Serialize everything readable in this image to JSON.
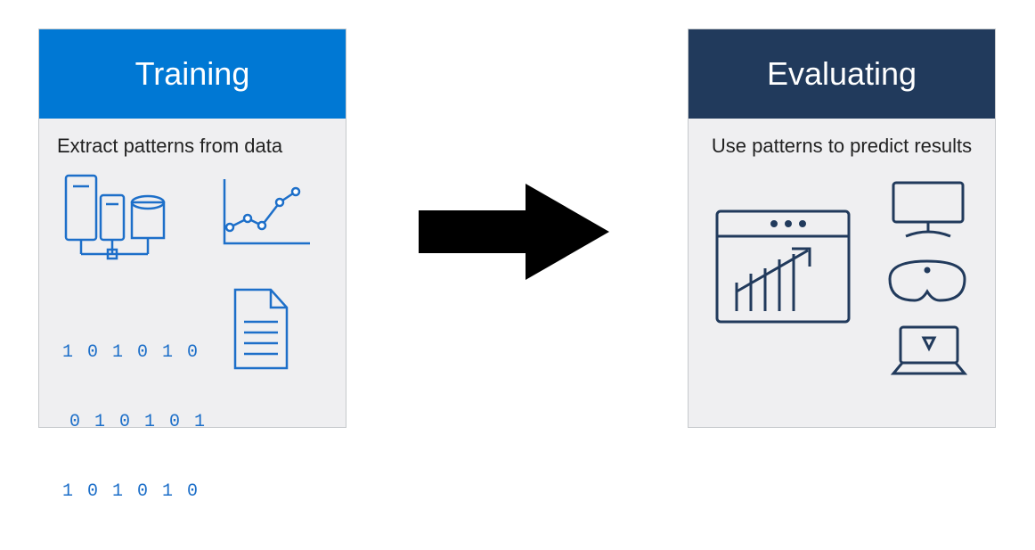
{
  "training": {
    "title": "Training",
    "description": "Extract patterns from data",
    "header_color": "#0078d4",
    "icon_color": "#1d6fc9",
    "binary_lines": [
      "1 0 1 0 1 0",
      "0 1 0 1 0 1",
      "1 0 1 0 1 0"
    ]
  },
  "evaluating": {
    "title": "Evaluating",
    "description": "Use patterns to predict results",
    "header_color": "#213a5c",
    "icon_color": "#213a5c"
  },
  "arrow_color": "#000000",
  "card_bg": "#efeff1"
}
